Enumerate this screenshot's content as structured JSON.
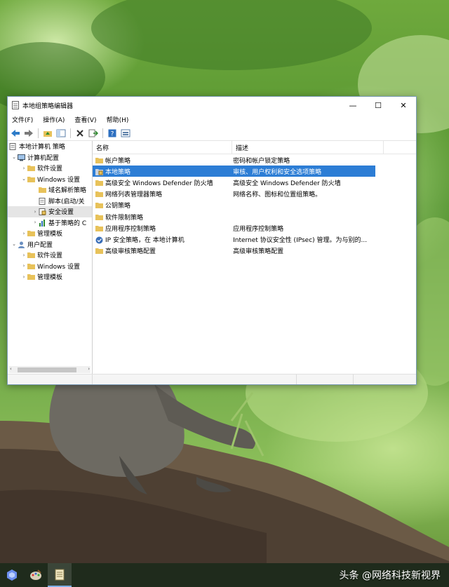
{
  "window": {
    "title": "本地组策略编辑器",
    "minimize": "—",
    "maximize": "☐",
    "close": "✕"
  },
  "menu": [
    "文件(F)",
    "操作(A)",
    "查看(V)",
    "帮助(H)"
  ],
  "tree": {
    "root": "本地计算机 策略",
    "computer_config": "计算机配置",
    "software_settings": "软件设置",
    "windows_settings": "Windows 设置",
    "name_resolution": "域名解析策略",
    "scripts": "脚本(启动/关",
    "security_settings": "安全设置",
    "qos": "基于策略的 C",
    "admin_templates": "管理模板",
    "user_config": "用户配置",
    "user_software": "软件设置",
    "user_windows": "Windows 设置",
    "user_admin": "管理模板"
  },
  "list": {
    "col_name": "名称",
    "col_desc": "描述",
    "rows": [
      {
        "name": "帐户策略",
        "desc": "密码和帐户锁定策略"
      },
      {
        "name": "本地策略",
        "desc": "审核、用户权利和安全选项策略"
      },
      {
        "name": "高级安全 Windows Defender 防火墙",
        "desc": "高级安全 Windows Defender 防火墙"
      },
      {
        "name": "网络列表管理器策略",
        "desc": "网络名称、图标和位置组策略。"
      },
      {
        "name": "公钥策略",
        "desc": ""
      },
      {
        "name": "软件限制策略",
        "desc": ""
      },
      {
        "name": "应用程序控制策略",
        "desc": "应用程序控制策略"
      },
      {
        "name": "IP 安全策略，在 本地计算机",
        "desc": "Internet 协议安全性 (IPsec) 管理。为与别的..."
      },
      {
        "name": "高级审核策略配置",
        "desc": "高级审核策略配置"
      }
    ]
  },
  "watermark": "头条 @网络科技新视界",
  "colors": {
    "selection": "#2c7dd5",
    "folder": "#e8c25a",
    "taskbar": "#1f2b1c"
  }
}
